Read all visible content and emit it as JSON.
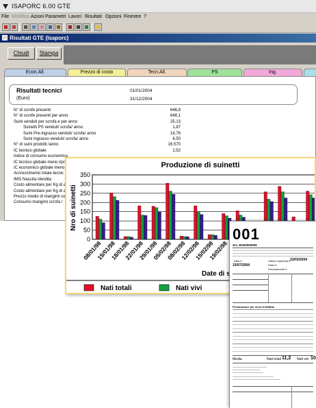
{
  "window": {
    "title": "ISAPORC 6.00  GTE"
  },
  "menu": [
    {
      "label": "File",
      "enabled": true
    },
    {
      "label": "Modifica",
      "enabled": false
    },
    {
      "label": "Azioni",
      "enabled": true
    },
    {
      "label": "Parametri",
      "enabled": true
    },
    {
      "label": "Lavori",
      "enabled": true
    },
    {
      "label": "Risultati",
      "enabled": true
    },
    {
      "label": "Opzioni",
      "enabled": true
    },
    {
      "label": "Finestre",
      "enabled": true
    },
    {
      "label": "?",
      "enabled": true
    }
  ],
  "toolbar": {
    "icons": [
      "exit-icon",
      "herd-icon",
      "print-icon",
      "mail-icon",
      "pig-icon",
      "calendar-icon",
      "tools-icon",
      "report-icon",
      "grid-icon",
      "chart-icon",
      "help-icon"
    ]
  },
  "child_window": {
    "title": "Risultati GTE (Isaporc)"
  },
  "actions": {
    "close_label": "Chiudi",
    "print_label": "Stampa"
  },
  "tabs": [
    {
      "label": "Econ.All.",
      "color": "#bfd0e8"
    },
    {
      "label": "Prezzo di costo",
      "color": "#f4ee98"
    },
    {
      "label": "Tecn.All.",
      "color": "#f0d4bc"
    },
    {
      "label": "PS",
      "color": "#9ee29a"
    },
    {
      "label": "Ing.",
      "color": "#f0a8d8"
    },
    {
      "label": "",
      "color": "#a8e0e8"
    }
  ],
  "results": {
    "title": "Risultati tecnici",
    "subtitle": "(Euro)",
    "date_from": "01/01/2004",
    "date_to": "31/12/2004",
    "rows": [
      {
        "label": "N° di scrofe presenti",
        "value": "646,8",
        "indent": false
      },
      {
        "label": "N° di scrofe presenti per anno",
        "value": "648,1",
        "indent": false
      },
      {
        "label": "Suini venduti per scrofa e per anno",
        "value": "25,13",
        "indent": false
      },
      {
        "label": "Suinetti PS venduti/ scrofa/ anno",
        "value": "1,87",
        "indent": true
      },
      {
        "label": "Suini Pre-ingrasso venduti/ scrofa/ anno",
        "value": "16,76",
        "indent": true
      },
      {
        "label": "Suini ingrasso venduti/ scrofa/ anno",
        "value": "6,50",
        "indent": true
      },
      {
        "label": "N° di suini prodotti /anno",
        "value": "16.570",
        "indent": false
      },
      {
        "label": "IC tecnico globale",
        "value": "2,52",
        "indent": false
      },
      {
        "label": "Indice di consumo economico",
        "value": "",
        "indent": false
      },
      {
        "label": "IC tecnico globale meno ripr",
        "value": "",
        "indent": false
      },
      {
        "label": "IC economico globale meno r",
        "value": "",
        "indent": false
      },
      {
        "label": "Accrescimento totale tecnic",
        "value": "",
        "indent": false
      },
      {
        "label": "IMG Nascita-Vendita",
        "value": "",
        "indent": false
      },
      {
        "label": "Costo alimentare per Kg di a",
        "value": "",
        "indent": false
      },
      {
        "label": "Costo alimentare per Kg di a",
        "value": "",
        "indent": false
      },
      {
        "label": "Prezzo medio di mangimi con",
        "value": "",
        "indent": false
      },
      {
        "label": "Consumo mangimi scrofa /",
        "value": "",
        "indent": false
      }
    ]
  },
  "chart_data": {
    "type": "bar",
    "title": "Produzione di suinetti",
    "xlabel": "Date di svezzame",
    "ylabel": "Nro di suinetti",
    "ylim": [
      0,
      350
    ],
    "yticks": [
      "0",
      "50",
      "100",
      "150",
      "200",
      "250",
      "300",
      "350"
    ],
    "grid": true,
    "legend_position": "bottom",
    "categories": [
      "08/01/98",
      "15/01/98",
      "18/01/98",
      "22/01/98",
      "29/01/98",
      "05/02/98",
      "08/02/98",
      "12/02/98",
      "15/02/98",
      "19/02/98",
      "",
      "",
      "",
      "",
      "",
      ""
    ],
    "xtick_labels": [
      "08/01/98",
      "15/01/98",
      "18/01/98",
      "22/01/98",
      "29/01/98",
      "05/02/98",
      "08/02/98",
      "12/02/98",
      "15/02/98",
      "19/02/98"
    ],
    "series": [
      {
        "name": "Nati totali",
        "color": "#e0102a",
        "values": [
          125,
          252,
          15,
          182,
          180,
          305,
          18,
          182,
          25,
          140,
          155,
          12,
          258,
          288,
          122,
          262
        ]
      },
      {
        "name": "Nati vivi",
        "color": "#10a040",
        "values": [
          110,
          232,
          15,
          132,
          172,
          262,
          15,
          152,
          25,
          128,
          132,
          10,
          218,
          258,
          12,
          242
        ]
      },
      {
        "name": "",
        "color": "#3a1a90",
        "values": [
          90,
          212,
          12,
          130,
          150,
          245,
          14,
          135,
          22,
          115,
          120,
          9,
          205,
          225,
          10,
          225
        ]
      }
    ],
    "colors": {
      "red": "#e0102a",
      "green": "#10a040",
      "purple": "#3a1a90"
    }
  },
  "document": {
    "number": "001",
    "line1": "Scr. BS00000005",
    "date": "23/03/2004",
    "born_label": "Nato il",
    "born_value": "15/07/2004",
    "labels": [
      "Ultimo copertura il",
      "Parto il",
      "Svezzamento il"
    ],
    "table_title": "Performance per ciclo di fattilità",
    "footer_mean": "Media",
    "footer_total_label": "Nati totali",
    "footer_total": "11,2",
    "footer_vivi_label": "Nati vivi",
    "footer_vivi": "10"
  }
}
